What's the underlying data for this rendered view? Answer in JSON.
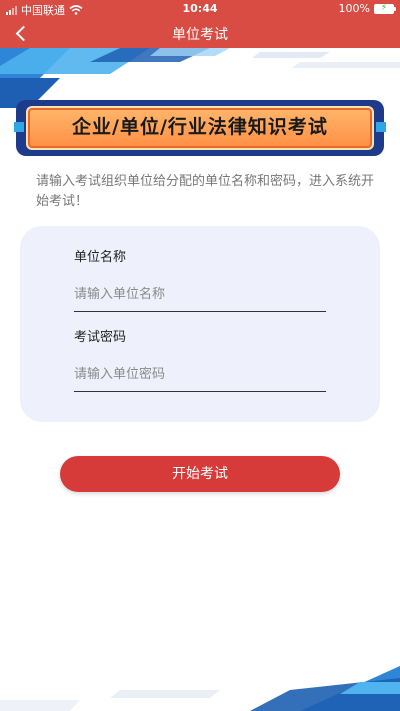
{
  "status_bar": {
    "carrier": "中国联通",
    "time": "10:44",
    "battery": "100%",
    "signal_icon": "signal-bars-icon",
    "wifi_icon": "wifi-icon",
    "battery_icon": "battery-charging-icon"
  },
  "nav": {
    "title": "单位考试",
    "back_icon": "chevron-left-icon"
  },
  "banner": {
    "title": "企业/单位/行业法律知识考试"
  },
  "intro": {
    "text": "请输入考试组织单位给分配的单位名称和密码，进入系统开始考试！"
  },
  "form": {
    "unit_name_label": "单位名称",
    "unit_name_placeholder": "请输入单位名称",
    "unit_name_value": "",
    "password_label": "考试密码",
    "password_placeholder": "请输入单位密码",
    "password_value": ""
  },
  "actions": {
    "start_label": "开始考试"
  },
  "colors": {
    "header_red": "#d94c44",
    "button_red": "#d63b3a",
    "banner_orange": "#ff8f44",
    "banner_navy": "#1e3a8a",
    "card_bg": "#eef1fb",
    "deco_blue": "#2fa6e8"
  }
}
